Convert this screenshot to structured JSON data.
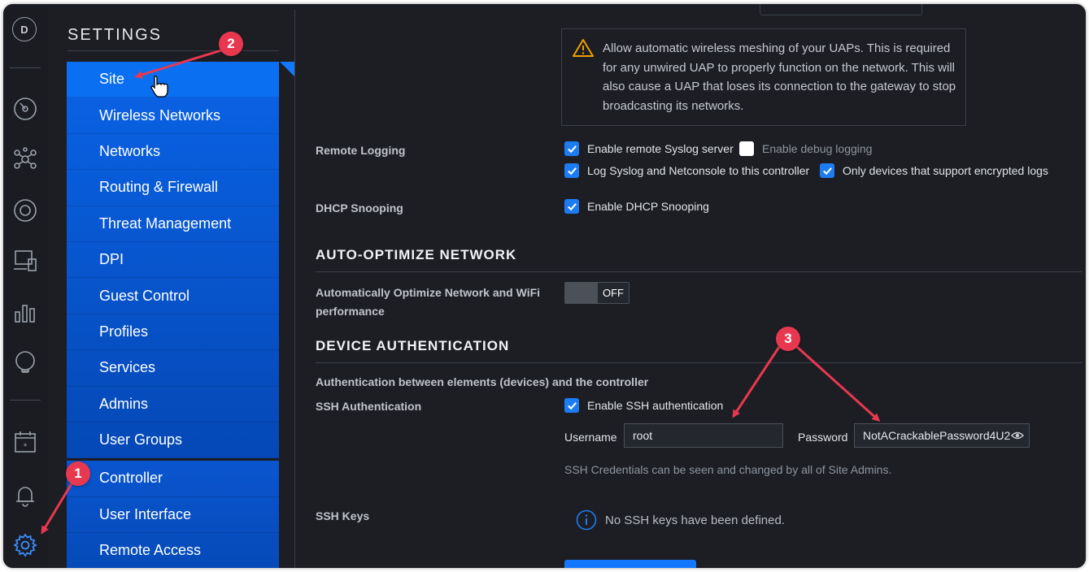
{
  "rail": {
    "avatar_initial": "D",
    "icons": [
      "dashboard-icon",
      "topology-icon",
      "devices-icon",
      "clients-icon",
      "statistics-icon",
      "insights-icon",
      "events-icon",
      "alerts-icon",
      "settings-icon"
    ]
  },
  "settings": {
    "title": "SETTINGS",
    "primary_items": [
      {
        "label": "Site",
        "active": true
      },
      {
        "label": "Wireless Networks"
      },
      {
        "label": "Networks"
      },
      {
        "label": "Routing & Firewall"
      },
      {
        "label": "Threat Management"
      },
      {
        "label": "DPI"
      },
      {
        "label": "Guest Control"
      },
      {
        "label": "Profiles"
      },
      {
        "label": "Services"
      },
      {
        "label": "Admins"
      },
      {
        "label": "User Groups"
      }
    ],
    "secondary_items": [
      {
        "label": "Controller"
      },
      {
        "label": "User Interface"
      },
      {
        "label": "Remote Access"
      }
    ]
  },
  "main": {
    "mesh_warning": "Allow automatic wireless meshing of your UAPs. This is required for any unwired UAP to properly function on the network. This will also cause a UAP that loses its connection to the gateway to stop broadcasting its networks.",
    "remote_logging": {
      "label": "Remote Logging",
      "enable_syslog": "Enable remote Syslog server",
      "enable_debug": "Enable debug logging",
      "log_netconsole": "Log Syslog and Netconsole to this controller",
      "encrypted_only": "Only devices that support encrypted logs"
    },
    "dhcp_snooping": {
      "label": "DHCP Snooping",
      "enable": "Enable DHCP Snooping"
    },
    "auto_optimize": {
      "section_title": "AUTO-OPTIMIZE NETWORK",
      "label": "Automatically Optimize Network and WiFi performance",
      "toggle_state": "OFF"
    },
    "device_auth": {
      "section_title": "DEVICE AUTHENTICATION",
      "description": "Authentication between elements (devices) and the controller",
      "ssh_label": "SSH Authentication",
      "enable_ssh": "Enable SSH authentication",
      "username_label": "Username",
      "username_value": "root",
      "password_label": "Password",
      "password_value": "NotACrackablePassword4U2",
      "credentials_hint": "SSH Credentials can be seen and changed by all of Site Admins.",
      "ssh_keys_label": "SSH Keys",
      "no_keys": "No SSH keys have been defined."
    }
  },
  "annotations": {
    "badge_1": "1",
    "badge_2": "2",
    "badge_3": "3",
    "color": "#e8384f"
  }
}
